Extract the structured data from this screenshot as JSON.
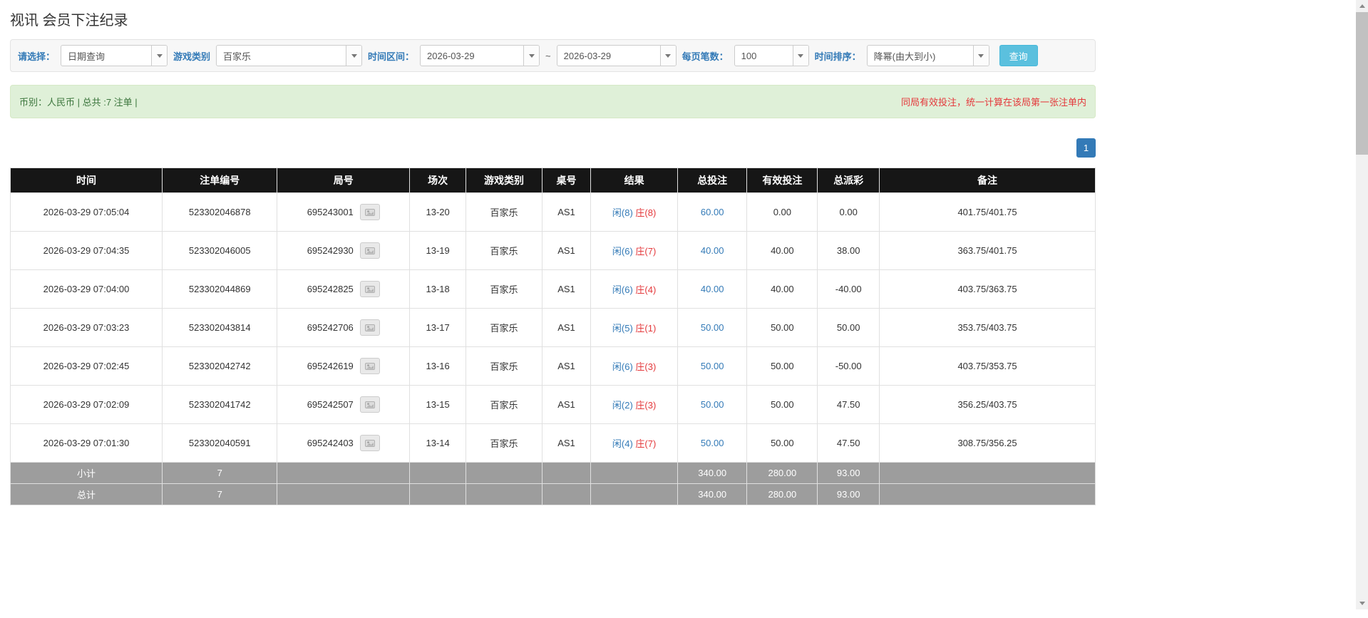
{
  "page": {
    "title": "视讯 会员下注纪录"
  },
  "filters": {
    "select_label": "请选择：",
    "select_value": "日期查询",
    "game_type_label": "游戏类别",
    "game_type_value": "百家乐",
    "time_range_label": "时间区间：",
    "date_from": "2026-03-29",
    "range_separator": "~",
    "date_to": "2026-03-29",
    "page_size_label": "每页笔数：",
    "page_size_value": "100",
    "sort_label": "时间排序：",
    "sort_value": "降幂(由大到小)",
    "search_button_label": "查询"
  },
  "info_bar": {
    "left_text": "币别：人民币 | 总共 :7 注单 |",
    "right_notice": "同局有效投注，统一计算在该局第一张注单内"
  },
  "pagination": {
    "current": "1"
  },
  "table": {
    "headers": [
      "时间",
      "注单编号",
      "局号",
      "场次",
      "游戏类别",
      "桌号",
      "结果",
      "总投注",
      "有效投注",
      "总派彩",
      "备注"
    ],
    "rows": [
      {
        "time": "2026-03-29 07:05:04",
        "bet_id": "523302046878",
        "round_id": "695243001",
        "session": "13-20",
        "game": "百家乐",
        "table_no": "AS1",
        "result_player": "闲(8)",
        "result_banker": "庄(8)",
        "total_bet": "60.00",
        "valid_bet": "0.00",
        "payout": "0.00",
        "remark": "401.75/401.75"
      },
      {
        "time": "2026-03-29 07:04:35",
        "bet_id": "523302046005",
        "round_id": "695242930",
        "session": "13-19",
        "game": "百家乐",
        "table_no": "AS1",
        "result_player": "闲(6)",
        "result_banker": "庄(7)",
        "total_bet": "40.00",
        "valid_bet": "40.00",
        "payout": "38.00",
        "remark": "363.75/401.75"
      },
      {
        "time": "2026-03-29 07:04:00",
        "bet_id": "523302044869",
        "round_id": "695242825",
        "session": "13-18",
        "game": "百家乐",
        "table_no": "AS1",
        "result_player": "闲(6)",
        "result_banker": "庄(4)",
        "total_bet": "40.00",
        "valid_bet": "40.00",
        "payout": "-40.00",
        "remark": "403.75/363.75"
      },
      {
        "time": "2026-03-29 07:03:23",
        "bet_id": "523302043814",
        "round_id": "695242706",
        "session": "13-17",
        "game": "百家乐",
        "table_no": "AS1",
        "result_player": "闲(5)",
        "result_banker": "庄(1)",
        "total_bet": "50.00",
        "valid_bet": "50.00",
        "payout": "50.00",
        "remark": "353.75/403.75"
      },
      {
        "time": "2026-03-29 07:02:45",
        "bet_id": "523302042742",
        "round_id": "695242619",
        "session": "13-16",
        "game": "百家乐",
        "table_no": "AS1",
        "result_player": "闲(6)",
        "result_banker": "庄(3)",
        "total_bet": "50.00",
        "valid_bet": "50.00",
        "payout": "-50.00",
        "remark": "403.75/353.75"
      },
      {
        "time": "2026-03-29 07:02:09",
        "bet_id": "523302041742",
        "round_id": "695242507",
        "session": "13-15",
        "game": "百家乐",
        "table_no": "AS1",
        "result_player": "闲(2)",
        "result_banker": "庄(3)",
        "total_bet": "50.00",
        "valid_bet": "50.00",
        "payout": "47.50",
        "remark": "356.25/403.75"
      },
      {
        "time": "2026-03-29 07:01:30",
        "bet_id": "523302040591",
        "round_id": "695242403",
        "session": "13-14",
        "game": "百家乐",
        "table_no": "AS1",
        "result_player": "闲(4)",
        "result_banker": "庄(7)",
        "total_bet": "50.00",
        "valid_bet": "50.00",
        "payout": "47.50",
        "remark": "308.75/356.25"
      }
    ],
    "subtotal": {
      "label": "小计",
      "count": "7",
      "total_bet": "340.00",
      "valid_bet": "280.00",
      "payout": "93.00"
    },
    "total": {
      "label": "总计",
      "count": "7",
      "total_bet": "340.00",
      "valid_bet": "280.00",
      "payout": "93.00"
    }
  },
  "colors": {
    "accent_blue": "#337ab7",
    "player_blue": "#337ab7",
    "banker_red": "#e4393c",
    "negative_red": "#e4393c",
    "query_button": "#5bc0de",
    "table_header_bg": "#161616",
    "info_bar_bg": "#dff0d8",
    "summary_row_bg": "#9d9d9d"
  },
  "icons": {
    "dropdown_caret": "caret-down",
    "round_replay": "game-replay",
    "scroll_up": "arrow-up",
    "scroll_down": "arrow-down"
  }
}
